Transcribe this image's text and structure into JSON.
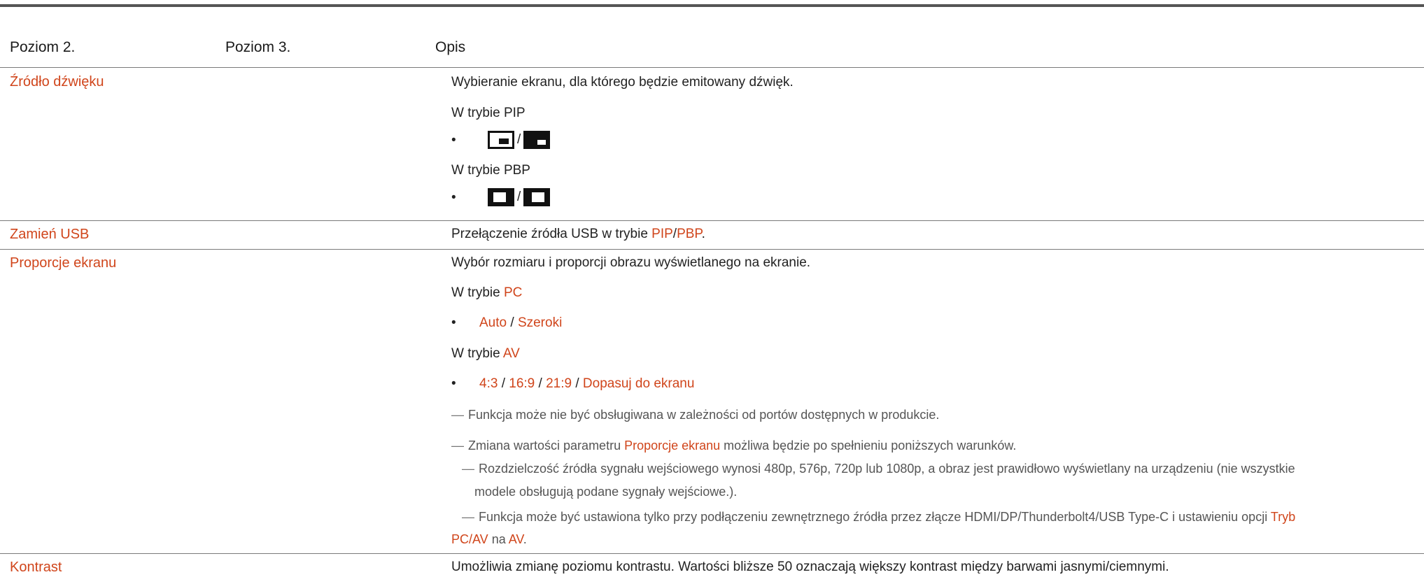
{
  "table": {
    "headers": [
      "Poziom 2.",
      "Poziom 3.",
      "Opis"
    ]
  },
  "rows": {
    "zrodlo": {
      "name": "Źródło dźwięku",
      "desc": "Wybieranie ekranu, dla którego będzie emitowany dźwięk.",
      "pip_mode": "W trybie PIP",
      "pbp_mode": "W trybie PBP",
      "bullet": "•",
      "slash": "/"
    },
    "usb": {
      "name": "Zamień USB",
      "desc_before": "Przełączenie źródła USB w trybie ",
      "pip": "PIP",
      "slash": "/",
      "pbp": "PBP",
      "desc_after": "."
    },
    "proporcje": {
      "name": "Proporcje ekranu",
      "desc": "Wybór rozmiaru i proporcji obrazu wyświetlanego na ekranie.",
      "mode_prefix": "W trybie ",
      "pc": "PC",
      "bullet": "•",
      "auto": "Auto",
      "sep": " / ",
      "szeroki": "Szeroki",
      "av": "AV",
      "r43": "4:3",
      "r169": "16:9",
      "r219": "21:9",
      "dopasuj": "Dopasuj do ekranu",
      "note_mark": "―",
      "note1": "Funkcja może nie być obsługiwana w zależności od portów dostępnych w produkcie.",
      "note2_before": "Zmiana wartości parametru ",
      "note2_hl": "Proporcje ekranu",
      "note2_after": " możliwa będzie po spełnieniu poniższych warunków.",
      "sub1_line1": "Rozdzielczość źródła sygnału wejściowego wynosi 480p, 576p, 720p lub 1080p, a obraz jest prawidłowo wyświetlany na urządzeniu (nie wszystkie",
      "sub1_line2": "modele obsługują podane sygnały wejściowe.).",
      "sub2_line1_before": "Funkcja może być ustawiona tylko przy podłączeniu zewnętrznego źródła przez złącze HDMI/DP/Thunderbolt4/USB Type-C i ustawieniu opcji ",
      "sub2_line1_hl": "Tryb",
      "sub2_line2_hl": "PC/AV",
      "sub2_line2_mid": " na ",
      "sub2_line2_av": "AV",
      "sub2_line2_end": "."
    },
    "kontrast": {
      "name": "Kontrast",
      "desc": "Umożliwia zmianę poziomu kontrastu. Wartości bliższe 50 oznaczają większy kontrast między barwami jasnymi/ciemnymi."
    }
  },
  "colors": {
    "accent": "#d0451b",
    "text": "#222222",
    "rule": "#7a7a7a"
  },
  "icons": [
    "pip-small-window-icon",
    "pip-large-window-icon",
    "pbp-left-icon",
    "pbp-right-icon"
  ]
}
